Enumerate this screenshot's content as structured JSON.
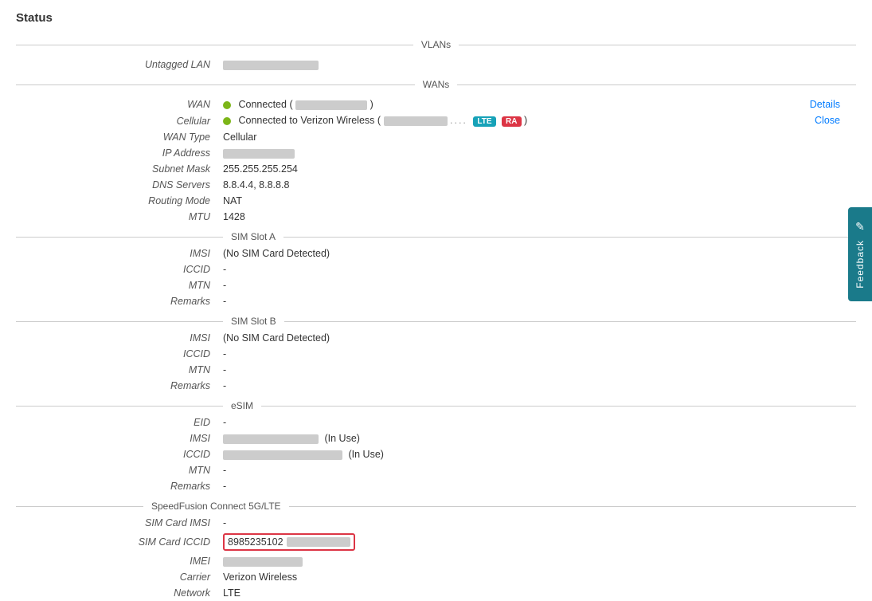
{
  "page": {
    "title": "Status"
  },
  "sections": {
    "vlans_label": "VLANs",
    "wans_label": "WANs",
    "untagged_lan_label": "Untagged LAN",
    "untagged_lan_value_blurred": true,
    "wan_label": "WAN",
    "wan_status": "Connected",
    "wan_ip_blurred": true,
    "wan_details_link": "Details",
    "cellular_label": "Cellular",
    "cellular_status": "Connected to Verizon Wireless (",
    "cellular_ip_blurred": true,
    "cellular_dots": "....",
    "cellular_badge_lte": "LTE",
    "cellular_badge_ra": "RA",
    "cellular_close_link": "Close",
    "wan_type_label": "WAN Type",
    "wan_type_value": "Cellular",
    "ip_address_label": "IP Address",
    "ip_address_blurred": true,
    "subnet_mask_label": "Subnet Mask",
    "subnet_mask_value": "255.255.255.254",
    "dns_servers_label": "DNS Servers",
    "dns_servers_value": "8.8.4.4, 8.8.8.8",
    "routing_mode_label": "Routing Mode",
    "routing_mode_value": "NAT",
    "mtu_label": "MTU",
    "mtu_value": "1428",
    "sim_slot_a_label": "SIM Slot A",
    "imsi_label": "IMSI",
    "imsi_a_value": "(No SIM Card Detected)",
    "iccid_label": "ICCID",
    "iccid_a_value": "-",
    "mtn_label": "MTN",
    "mtn_a_value": "-",
    "remarks_label": "Remarks",
    "remarks_a_value": "-",
    "sim_slot_b_label": "SIM Slot B",
    "imsi_b_value": "(No SIM Card Detected)",
    "iccid_b_value": "-",
    "mtn_b_value": "-",
    "remarks_b_value": "-",
    "esim_label": "eSIM",
    "eid_label": "EID",
    "eid_value": "-",
    "imsi_esim_blurred": true,
    "imsi_esim_suffix": "(In Use)",
    "iccid_esim_blurred": true,
    "iccid_esim_suffix": "(In Use)",
    "mtn_esim_value": "-",
    "remarks_esim_value": "-",
    "speedfusion_label": "SpeedFusion Connect 5G/LTE",
    "sim_card_imsi_label": "SIM Card IMSI",
    "sim_card_imsi_value": "-",
    "sim_card_iccid_label": "SIM Card ICCID",
    "sim_card_iccid_value": "8985235102",
    "sim_card_iccid_blurred": true,
    "imei_label": "IMEI",
    "imei_blurred": true,
    "carrier_label": "Carrier",
    "carrier_value": "Verizon Wireless",
    "network_label": "Network",
    "network_value": "LTE"
  },
  "feedback": {
    "label": "Feedback",
    "icon": "✎"
  }
}
